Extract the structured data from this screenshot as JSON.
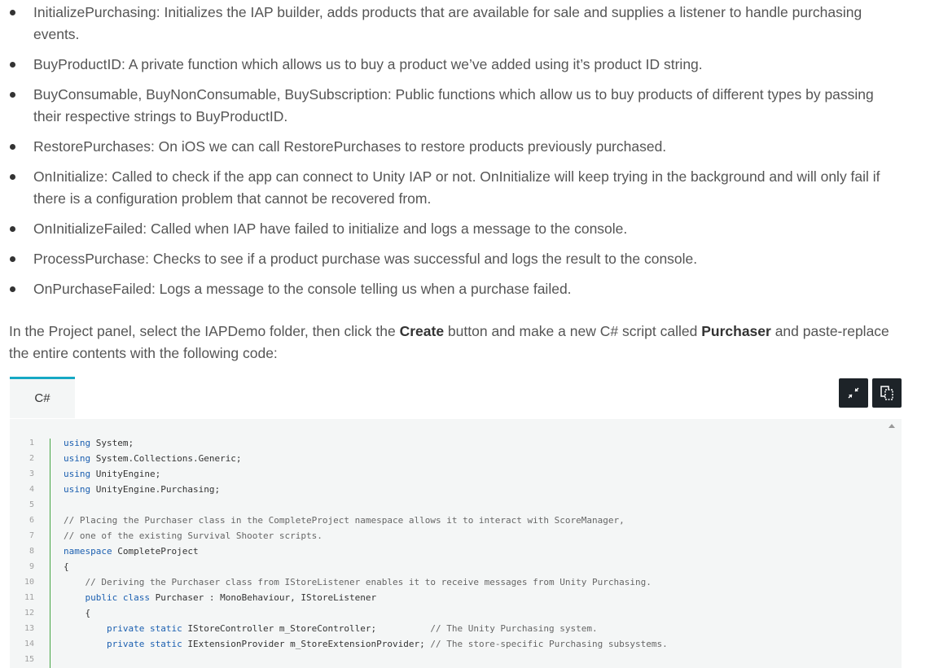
{
  "bullets": [
    {
      "line1": "InitializePurchasing: Initializes the IAP builder, adds products that are available for sale and supplies a listener to handle purchasing",
      "line2": "events."
    },
    {
      "line1": "BuyProductID: A private function which allows us to buy a product we’ve added using it’s product ID string.",
      "line2": ""
    },
    {
      "line1": "BuyConsumable, BuyNonConsumable, BuySubscription: Public functions which allow us to buy products of different types by passing",
      "line2": "their respective strings to BuyProductID."
    },
    {
      "line1": "RestorePurchases: On iOS we can call RestorePurchases to restore products previously purchased.",
      "line2": ""
    },
    {
      "line1": "OnInitialize: Called to check if the app can connect to Unity IAP or not. OnInitialize will keep trying in the background and will only fail if",
      "line2": "there is a configuration problem that cannot be recovered from."
    },
    {
      "line1": "OnInitializeFailed: Called when IAP have failed to initialize and logs a message to the console.",
      "line2": ""
    },
    {
      "line1": "ProcessPurchase: Checks to see if a product purchase was successful and logs the result to the console.",
      "line2": ""
    },
    {
      "line1": "OnPurchaseFailed: Logs a message to the console telling us when a purchase failed.",
      "line2": ""
    }
  ],
  "instructions": {
    "part1": "In the Project panel, select the IAPDemo folder, then click the ",
    "create": "Create",
    "part2": " button and make a new C# script called ",
    "purchaser": "Purchaser",
    "part3": " and paste-replace",
    "line2": "the entire contents with the following code:"
  },
  "code_block": {
    "tab_label": "C#",
    "expand_icon": "collapse-arrows-icon",
    "copy_icon": "copy-icon",
    "lines": [
      {
        "no": "1",
        "indent": "",
        "kw": "using",
        "text": " System;",
        "comment": ""
      },
      {
        "no": "2",
        "indent": "",
        "kw": "using",
        "text": " System.Collections.Generic;",
        "comment": ""
      },
      {
        "no": "3",
        "indent": "",
        "kw": "using",
        "text": " UnityEngine;",
        "comment": ""
      },
      {
        "no": "4",
        "indent": "",
        "kw": "using",
        "text": " UnityEngine.Purchasing;",
        "comment": ""
      },
      {
        "no": "5",
        "indent": "",
        "kw": "",
        "text": "",
        "comment": ""
      },
      {
        "no": "6",
        "indent": "",
        "kw": "",
        "text": "",
        "comment": "// Placing the Purchaser class in the CompleteProject namespace allows it to interact with ScoreManager,"
      },
      {
        "no": "7",
        "indent": "",
        "kw": "",
        "text": "",
        "comment": "// one of the existing Survival Shooter scripts."
      },
      {
        "no": "8",
        "indent": "",
        "kw": "namespace",
        "text": " CompleteProject",
        "comment": ""
      },
      {
        "no": "9",
        "indent": "",
        "kw": "",
        "text": "{",
        "comment": ""
      },
      {
        "no": "10",
        "indent": "    ",
        "kw": "",
        "text": "",
        "comment": "// Deriving the Purchaser class from IStoreListener enables it to receive messages from Unity Purchasing."
      },
      {
        "no": "11",
        "indent": "    ",
        "kw": "public class",
        "text": " Purchaser : MonoBehaviour, IStoreListener",
        "comment": ""
      },
      {
        "no": "12",
        "indent": "    ",
        "kw": "",
        "text": "{",
        "comment": ""
      },
      {
        "no": "13",
        "indent": "        ",
        "kw": "private static",
        "text": " IStoreController m_StoreController;          ",
        "comment": "// The Unity Purchasing system."
      },
      {
        "no": "14",
        "indent": "        ",
        "kw": "private static",
        "text": " IExtensionProvider m_StoreExtensionProvider; ",
        "comment": "// The store-specific Purchasing subsystems."
      },
      {
        "no": "15",
        "indent": "",
        "kw": "",
        "text": "",
        "comment": ""
      }
    ]
  }
}
